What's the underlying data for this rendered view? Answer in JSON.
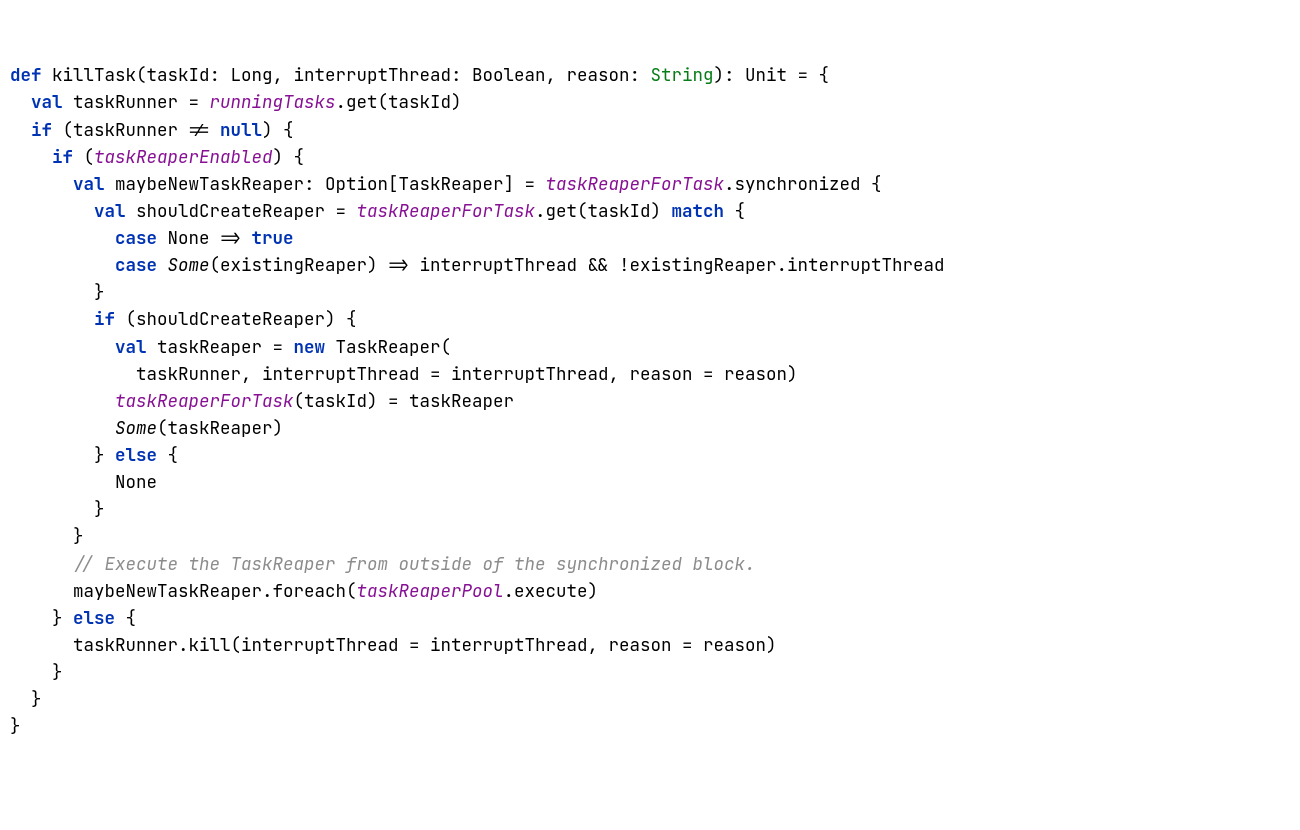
{
  "code": {
    "t": {
      "def": "def",
      "val": "val",
      "if": "if",
      "else": "else",
      "new": "new",
      "case": "case",
      "match": "match",
      "true": "true",
      "null": "null",
      "killTask": "killTask",
      "taskId": "taskId",
      "Long": "Long",
      "interruptThread": "interruptThread",
      "Boolean": "Boolean",
      "reason": "reason",
      "String": "String",
      "Unit": "Unit",
      "taskRunner": "taskRunner",
      "runningTasks": "runningTasks",
      "get": "get",
      "taskReaperEnabled": "taskReaperEnabled",
      "maybeNewTaskReaper": "maybeNewTaskReaper",
      "Option": "Option",
      "TaskReaper": "TaskReaper",
      "taskReaperForTask": "taskReaperForTask",
      "synchronized": "synchronized",
      "shouldCreateReaper": "shouldCreateReaper",
      "None": "None",
      "Some": "Some",
      "existingReaper": "existingReaper",
      "taskReaper": "taskReaper",
      "comment": "// Execute the TaskReaper from outside of the synchronized block.",
      "foreach": "foreach",
      "taskReaperPool": "taskReaperPool",
      "execute": "execute",
      "kill": "kill"
    }
  }
}
